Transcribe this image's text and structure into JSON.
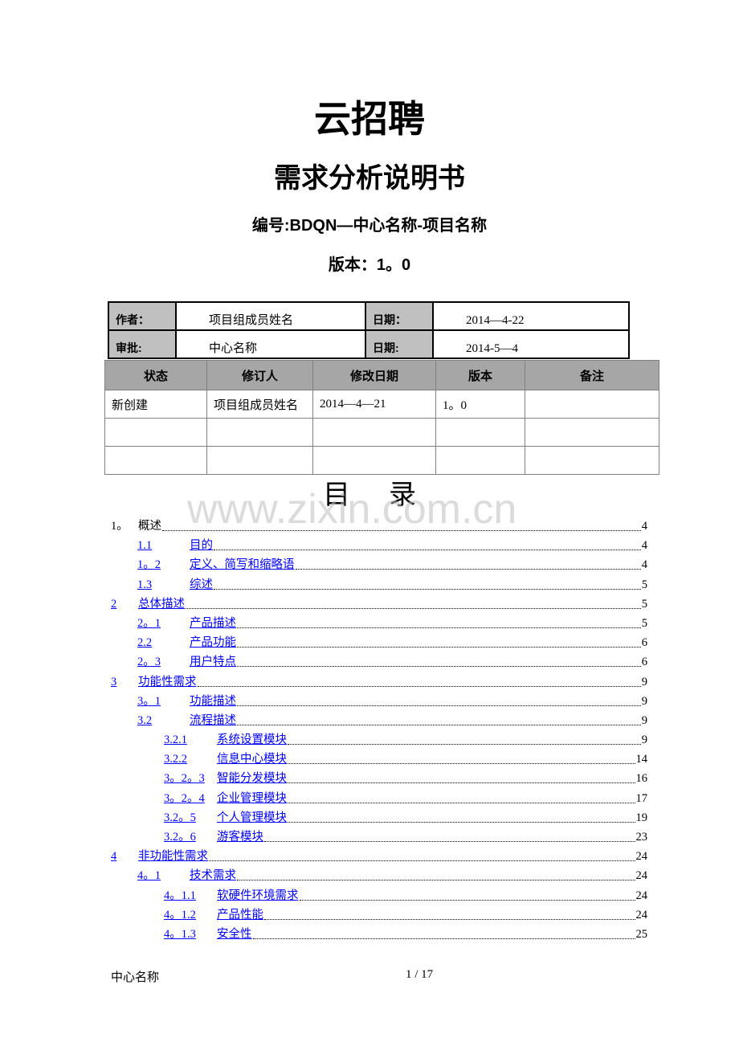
{
  "cover": {
    "title": "云招聘",
    "subtitle": "需求分析说明书",
    "code": "编号:BDQN—中心名称-项目名称",
    "version": "版本：1。0"
  },
  "meta_table": {
    "rows": [
      {
        "label1": "作者：",
        "value1": "项目组成员姓名",
        "label2": "日期：",
        "value2": "2014—4-22"
      },
      {
        "label1": "审批:",
        "value1": "中心名称",
        "label2": "日期:",
        "value2": "2014-5—4"
      }
    ]
  },
  "revision_table": {
    "headers": [
      "状态",
      "修订人",
      "修改日期",
      "版本",
      "备注"
    ],
    "rows": [
      [
        "新创建",
        "项目组成员姓名",
        "2014—4—21",
        "1。0",
        ""
      ],
      [
        "",
        "",
        "",
        "",
        ""
      ],
      [
        "",
        "",
        "",
        "",
        ""
      ]
    ]
  },
  "toc": {
    "title": "目录",
    "watermark": "www.zixin.com.cn",
    "entries": [
      {
        "num": "1。",
        "label": "概述",
        "page": "4",
        "level": 1,
        "link": false
      },
      {
        "num": "1.1",
        "label": "目的",
        "page": "4",
        "level": 2,
        "link": true
      },
      {
        "num": "1。2",
        "label": "定义、简写和缩略语",
        "page": "4",
        "level": 2,
        "link": true
      },
      {
        "num": "1.3",
        "label": "综述",
        "page": "5",
        "level": 2,
        "link": true
      },
      {
        "num": "2",
        "label": "总体描述",
        "page": "5",
        "level": 1,
        "link": true
      },
      {
        "num": "2。1",
        "label": "产品描述",
        "page": "5",
        "level": 2,
        "link": true
      },
      {
        "num": "2.2",
        "label": "产品功能",
        "page": "6",
        "level": 2,
        "link": true
      },
      {
        "num": "2。3",
        "label": "用户特点",
        "page": "6",
        "level": 2,
        "link": true
      },
      {
        "num": "3",
        "label": "功能性需求",
        "page": "9",
        "level": 1,
        "link": true
      },
      {
        "num": "3。1",
        "label": "功能描述",
        "page": "9",
        "level": 2,
        "link": true
      },
      {
        "num": "3.2",
        "label": "流程描述",
        "page": "9",
        "level": 2,
        "link": true
      },
      {
        "num": "3.2.1",
        "label": "系统设置模块",
        "page": "9",
        "level": 3,
        "link": true
      },
      {
        "num": "3.2.2",
        "label": "信息中心模块",
        "page": "14",
        "level": 3,
        "link": true
      },
      {
        "num": "3。2。3",
        "label": "智能分发模块",
        "page": "16",
        "level": 3,
        "link": true
      },
      {
        "num": "3。2。4",
        "label": "企业管理模块",
        "page": "17",
        "level": 3,
        "link": true
      },
      {
        "num": "3.2。5",
        "label": "个人管理模块",
        "page": "19",
        "level": 3,
        "link": true
      },
      {
        "num": "3.2。6",
        "label": "游客模块",
        "page": "23",
        "level": 3,
        "link": true
      },
      {
        "num": "4",
        "label": "非功能性需求",
        "page": "24",
        "level": 1,
        "link": true
      },
      {
        "num": "4。1",
        "label": "技术需求",
        "page": "24",
        "level": 2,
        "link": true
      },
      {
        "num": "4。1.1",
        "label": "软硬件环境需求",
        "page": "24",
        "level": 3,
        "link": true
      },
      {
        "num": "4。1.2",
        "label": "产品性能",
        "page": "24",
        "level": 3,
        "link": true
      },
      {
        "num": "4。1.3",
        "label": "安全性",
        "page": "25",
        "level": 3,
        "link": true
      }
    ]
  },
  "footer": {
    "left": "中心名称",
    "page": "1 / 17"
  }
}
